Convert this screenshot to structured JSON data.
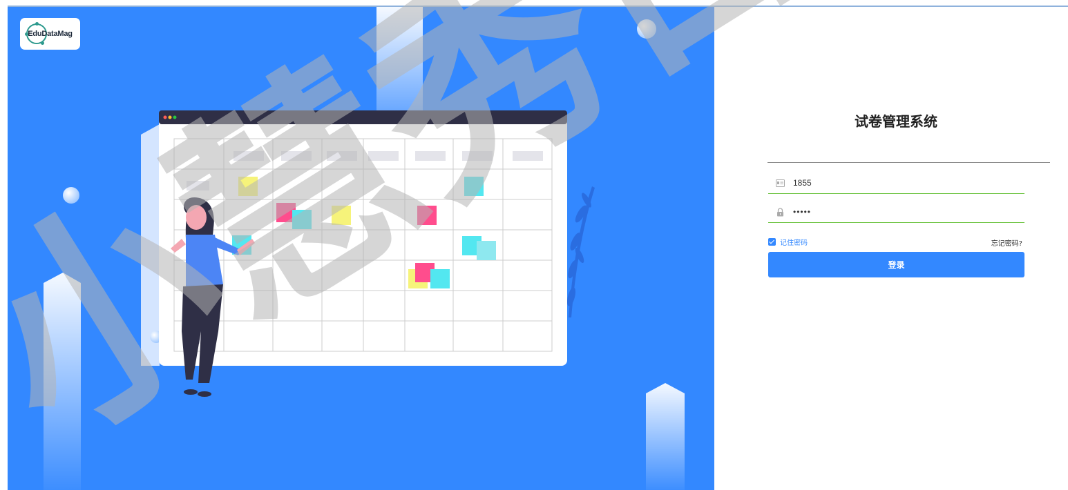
{
  "logo": {
    "text": "EduDataMag"
  },
  "login": {
    "title": "试卷管理系统",
    "username_value": "1855",
    "password_value": "•••••",
    "remember_label": "记住密码",
    "remember_checked": true,
    "forgot_label": "忘记密码?",
    "submit_label": "登录"
  },
  "watermark": {
    "text": "小慧秀日教"
  },
  "colors": {
    "primary": "#3388ff",
    "hero_background": "#3388ff",
    "input_underline": "#67c23a",
    "window_titlebar": "#2f2f46",
    "note_yellow": "#f6f37a",
    "note_pink": "#ff4d8d",
    "note_cyan": "#53e7f0"
  },
  "icons": {
    "username": "id-card-icon",
    "password": "lock-icon",
    "remember": "checkbox-checked-icon"
  }
}
